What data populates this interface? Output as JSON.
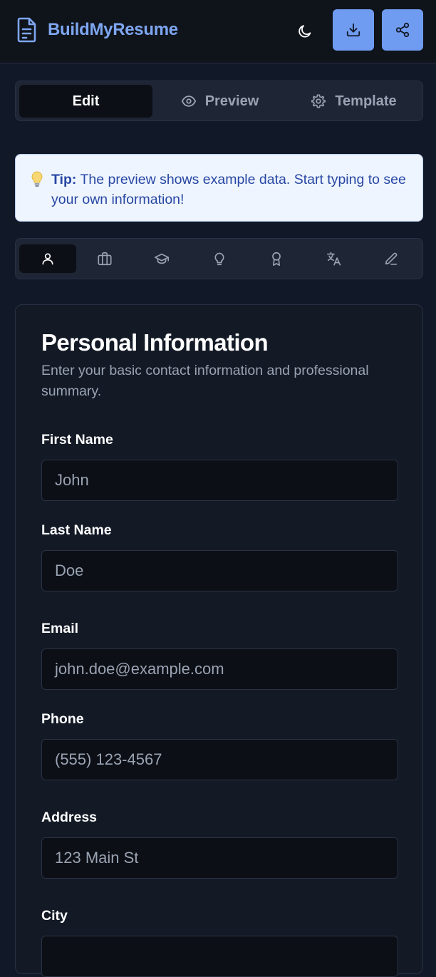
{
  "header": {
    "app_name": "BuildMyResume",
    "icons": {
      "logo": "document-icon",
      "theme": "moon-icon",
      "download": "download-icon",
      "share": "share-icon"
    },
    "accent_color": "#6f9cf0"
  },
  "view_tabs": [
    {
      "label": "Edit",
      "icon": "",
      "active": true
    },
    {
      "label": "Preview",
      "icon": "eye-icon",
      "active": false
    },
    {
      "label": "Template",
      "icon": "gear-icon",
      "active": false
    }
  ],
  "tip": {
    "icon": "lightbulb-icon",
    "bold": "Tip:",
    "text": " The preview shows example data. Start typing to see your own information!"
  },
  "section_tabs": [
    {
      "icon": "user-icon",
      "active": true
    },
    {
      "icon": "briefcase-icon",
      "active": false
    },
    {
      "icon": "graduation-cap-icon",
      "active": false
    },
    {
      "icon": "lightbulb-icon",
      "active": false
    },
    {
      "icon": "award-icon",
      "active": false
    },
    {
      "icon": "languages-icon",
      "active": false
    },
    {
      "icon": "pencil-icon",
      "active": false
    }
  ],
  "form": {
    "title": "Personal Information",
    "description": "Enter your basic contact information and professional summary.",
    "fields": [
      {
        "label": "First Name",
        "placeholder": "John",
        "value": ""
      },
      {
        "label": "Last Name",
        "placeholder": "Doe",
        "value": ""
      },
      {
        "label": "Email",
        "placeholder": "john.doe@example.com",
        "value": ""
      },
      {
        "label": "Phone",
        "placeholder": "(555) 123-4567",
        "value": ""
      },
      {
        "label": "Address",
        "placeholder": "123 Main St",
        "value": ""
      },
      {
        "label": "City",
        "placeholder": "",
        "value": ""
      }
    ]
  }
}
